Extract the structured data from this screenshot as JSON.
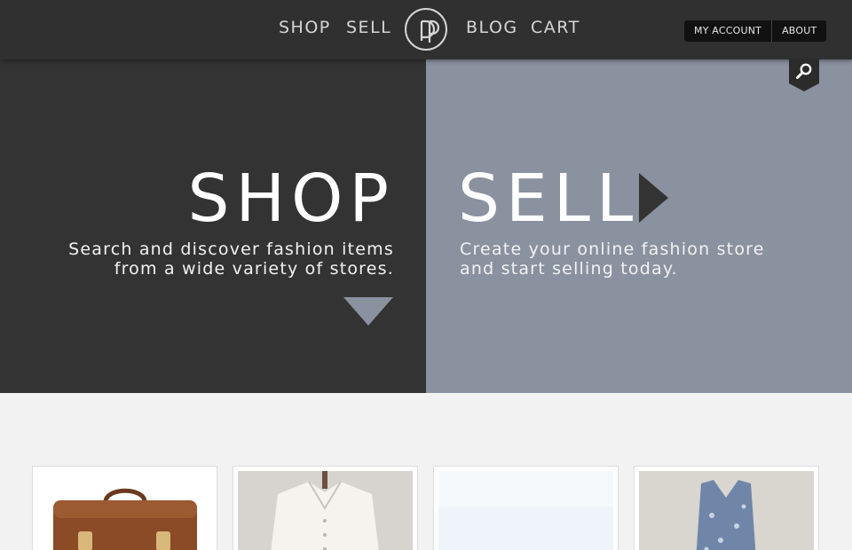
{
  "nav": {
    "shop": "SHOP",
    "sell": "SELL",
    "blog": "BLOG",
    "cart": "CART"
  },
  "account": {
    "my_account": "MY ACCOUNT",
    "about": "ABOUT"
  },
  "icons": {
    "logo": "dp-logo-icon",
    "search": "search-icon",
    "shop_arrow": "down-triangle-icon",
    "sell_arrow": "right-triangle-icon"
  },
  "hero": {
    "shop": {
      "title": "SHOP",
      "line1": "Search and discover fashion items",
      "line2": "from a wide variety of stores."
    },
    "sell": {
      "title": "SELL",
      "line1": "Create your online fashion store",
      "line2": "and start selling today."
    }
  },
  "products": [
    {
      "image": "brown-leather-satchel"
    },
    {
      "image": "white-sleeveless-blouse"
    },
    {
      "image": "light-blue-item"
    },
    {
      "image": "blue-floral-vest-top"
    }
  ],
  "colors": {
    "topbar": "#303030",
    "shop_panel": "#333333",
    "sell_panel": "#8a919f",
    "page_bg": "#f2f2f2"
  }
}
